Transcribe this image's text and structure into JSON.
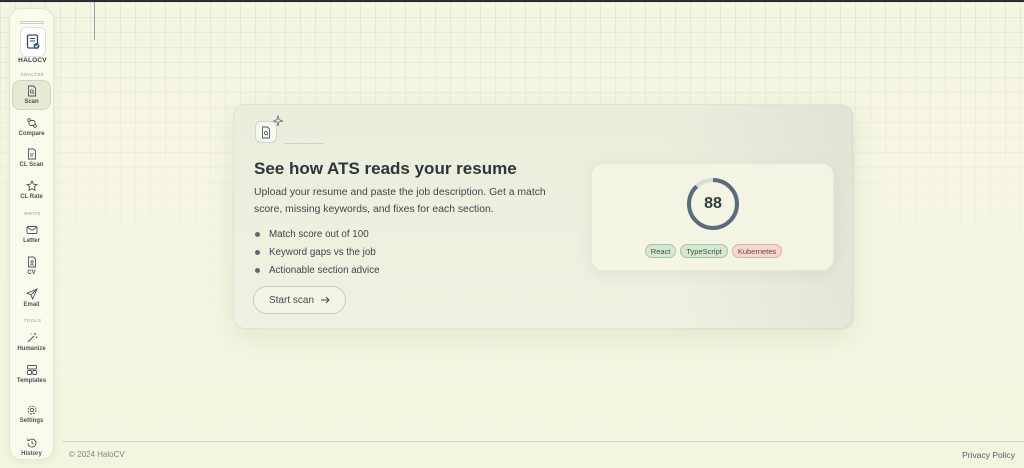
{
  "app": {
    "brand": "HALOCV"
  },
  "sidebar": {
    "sections": {
      "analyze": "ANALYZE",
      "write": "WRITE",
      "tools": "TOOLS"
    },
    "items": [
      {
        "label": "Scan",
        "icon": "file-search-icon",
        "active": true
      },
      {
        "label": "Compare",
        "icon": "git-compare-icon"
      },
      {
        "label": "CL Scan",
        "icon": "file-text-icon"
      },
      {
        "label": "CL Rate",
        "icon": "star-icon"
      },
      {
        "label": "Letter",
        "icon": "mail-icon"
      },
      {
        "label": "CV",
        "icon": "file-user-icon"
      },
      {
        "label": "Email",
        "icon": "send-icon"
      },
      {
        "label": "Humanize",
        "icon": "wand-icon"
      },
      {
        "label": "Templates",
        "icon": "layout-icon"
      },
      {
        "label": "Settings",
        "icon": "gear-icon"
      },
      {
        "label": "History",
        "icon": "history-icon"
      }
    ]
  },
  "hero": {
    "title": "See how ATS reads your resume",
    "description": "Upload your resume and paste the job description. Get a match score, missing keywords, and fixes for each section.",
    "bullets": [
      "Match score out of 100",
      "Keyword gaps vs the job",
      "Actionable section advice"
    ],
    "cta": "Start scan"
  },
  "score_panel": {
    "score": "88",
    "score_fraction": 0.88,
    "tags": [
      {
        "label": "React",
        "status": "matched"
      },
      {
        "label": "TypeScript",
        "status": "matched"
      },
      {
        "label": "Kubernetes",
        "status": "missing"
      }
    ]
  },
  "footer": {
    "copyright": "© 2024 HaloCV",
    "privacy": "Privacy Policy"
  },
  "colors": {
    "accent": "#5b6b7d",
    "matched": "#d7e7d4",
    "missing": "#f2d9d2",
    "background": "#f5f6e2"
  }
}
